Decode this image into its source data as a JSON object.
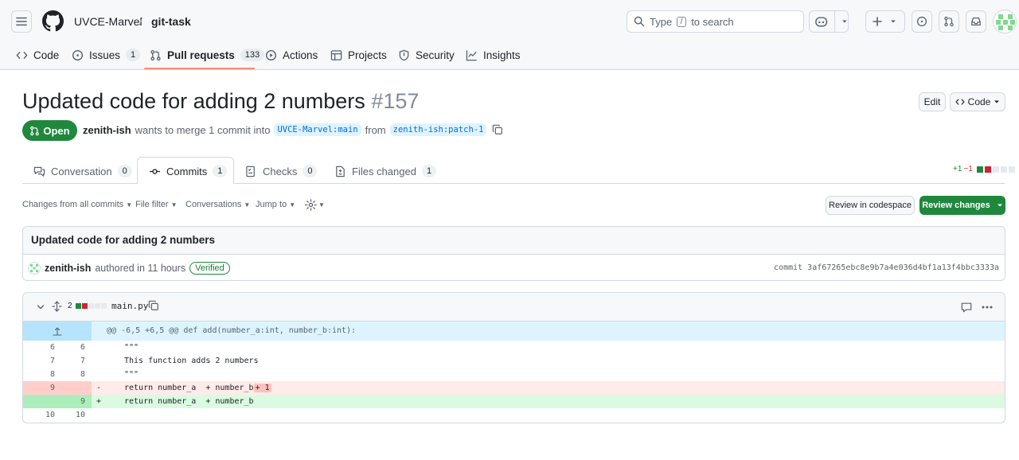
{
  "header": {
    "owner": "UVCE-Marvel",
    "separator": "/",
    "repo": "git-task",
    "search_prefix": "Type",
    "search_key": "/",
    "search_suffix": "to search"
  },
  "repo_tabs": [
    {
      "label": "Code"
    },
    {
      "label": "Issues",
      "count": "1"
    },
    {
      "label": "Pull requests",
      "count": "133"
    },
    {
      "label": "Actions"
    },
    {
      "label": "Projects"
    },
    {
      "label": "Security"
    },
    {
      "label": "Insights"
    }
  ],
  "pr": {
    "title": "Updated code for adding 2 numbers",
    "number": "#157",
    "state": "Open",
    "author": "zenith-ish",
    "merge_text": "wants to merge 1 commit into",
    "base_branch": "UVCE-Marvel:main",
    "from_text": "from",
    "head_branch": "zenith-ish:patch-1",
    "edit_label": "Edit",
    "code_label": "Code"
  },
  "pr_tabs": [
    {
      "label": "Conversation",
      "count": "0"
    },
    {
      "label": "Commits",
      "count": "1"
    },
    {
      "label": "Checks",
      "count": "0"
    },
    {
      "label": "Files changed",
      "count": "1"
    }
  ],
  "diffstat": {
    "additions": "+1",
    "deletions": "−1"
  },
  "toolbar": {
    "changes_from": "Changes from all commits",
    "file_filter": "File filter",
    "conversations": "Conversations",
    "jump_to": "Jump to",
    "review_codespace": "Review in codespace",
    "review_changes": "Review changes"
  },
  "commit": {
    "message": "Updated code for adding 2 numbers",
    "author": "zenith-ish",
    "authored_text": "authored in 11 hours",
    "verified": "Verified",
    "sha_text": "commit 3af67265ebc8e9b7a4e036d4bf1a13f4bbc3333a"
  },
  "file": {
    "changes": "2",
    "name": "main.py",
    "hunk": "@@ -6,5 +6,5 @@ def add(number_a:int, number_b:int):",
    "lines": [
      {
        "old": "6",
        "new": "6",
        "marker": "",
        "code": "\"\"\"",
        "type": "context"
      },
      {
        "old": "7",
        "new": "7",
        "marker": "",
        "code": "This function adds 2 numbers",
        "type": "context"
      },
      {
        "old": "8",
        "new": "8",
        "marker": "",
        "code": "\"\"\"",
        "type": "context"
      },
      {
        "old": "9",
        "new": "",
        "marker": "-",
        "code": "return number_a  + number_b",
        "extra": "+ 1",
        "type": "del"
      },
      {
        "old": "",
        "new": "9",
        "marker": "+",
        "code": "return number_a  + number_b",
        "type": "add"
      },
      {
        "old": "10",
        "new": "10",
        "marker": "",
        "code": "",
        "type": "context"
      }
    ]
  },
  "colors": {
    "accent": "#0969da",
    "open_green": "#1f883d",
    "tab_underline": "#fd8c73",
    "hunk_bg": "#ddf4ff",
    "del_bg": "#ffebe9",
    "del_num_bg": "#ffcecb",
    "add_bg": "#dafbe1",
    "add_num_bg": "#aceebb"
  },
  "icons": [
    "menu-icon",
    "github-logo-icon",
    "search-icon",
    "copilot-icon",
    "plus-icon",
    "issue-icon",
    "pull-request-icon",
    "inbox-icon",
    "avatar",
    "code-icon",
    "actions-icon",
    "table-icon",
    "shield-icon",
    "graph-icon",
    "copy-icon",
    "comment-icon",
    "commit-icon",
    "checklist-icon",
    "file-diff-icon",
    "gear-icon",
    "chevron-down-icon",
    "expand-icon",
    "kebab-icon"
  ]
}
